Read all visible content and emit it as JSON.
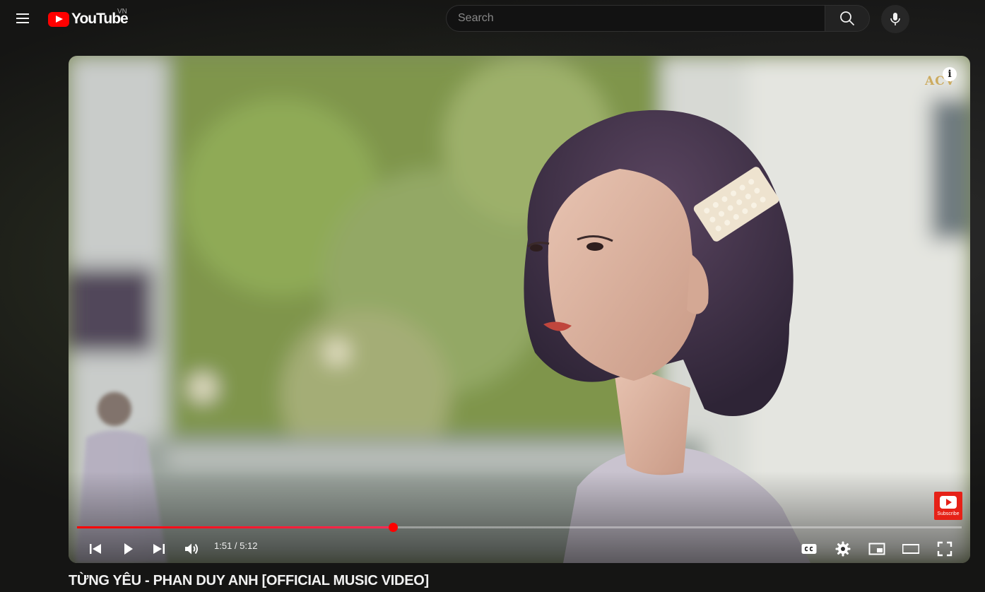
{
  "header": {
    "logo_text": "YouTube",
    "country_code": "VN",
    "search_placeholder": "Search"
  },
  "player": {
    "watermark": "ACV",
    "info_label": "i",
    "subscribe_label": "Subscribe",
    "time_display": "1:51 / 5:12",
    "progress_fraction": 0.357,
    "accent_color": "#ff0000"
  },
  "video": {
    "title": "TỪNG YÊU - PHAN DUY ANH [OFFICIAL MUSIC VIDEO]"
  },
  "icons": [
    "menu-icon",
    "youtube-logo-icon",
    "search-icon",
    "mic-icon",
    "info-icon",
    "prev-icon",
    "play-icon",
    "next-icon",
    "volume-icon",
    "cc-icon",
    "settings-icon",
    "miniplayer-icon",
    "theater-icon",
    "fullscreen-icon"
  ]
}
